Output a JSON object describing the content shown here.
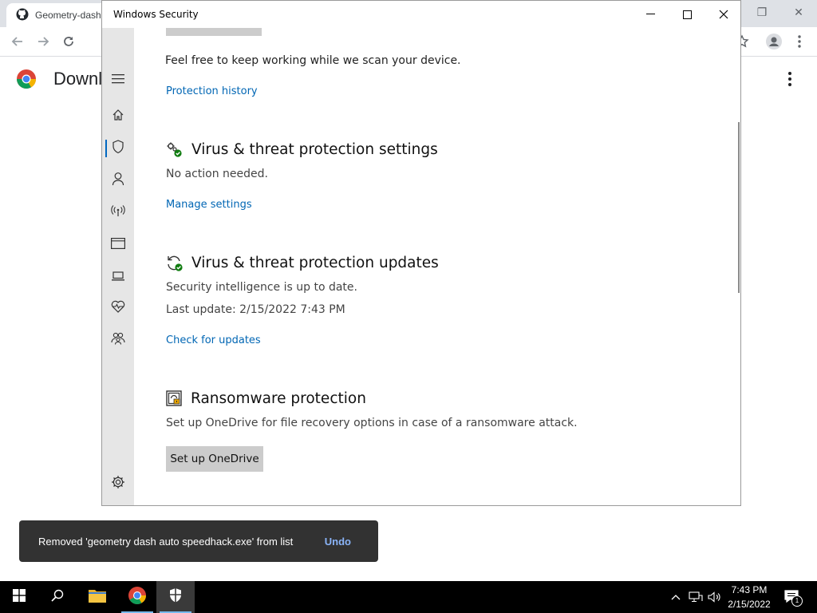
{
  "browser": {
    "tab_title": "Geometry-dash",
    "page_title": "Downl"
  },
  "window": {
    "title": "Windows Security"
  },
  "content": {
    "scan_message": "Feel free to keep working while we scan your device.",
    "protection_history_link": "Protection history",
    "settings": {
      "title": "Virus & threat protection settings",
      "status": "No action needed.",
      "link": "Manage settings"
    },
    "updates": {
      "title": "Virus & threat protection updates",
      "status": "Security intelligence is up to date.",
      "last_update": "Last update: 2/15/2022 7:43 PM",
      "link": "Check for updates"
    },
    "ransomware": {
      "title": "Ransomware protection",
      "description": "Set up OneDrive for file recovery options in case of a ransomware attack.",
      "button": "Set up OneDrive"
    }
  },
  "snackbar": {
    "message": "Removed 'geometry dash auto speedhack.exe' from list",
    "action": "Undo"
  },
  "taskbar": {
    "time": "7:43 PM",
    "date": "2/15/2022",
    "notification_count": "1"
  },
  "colors": {
    "link": "#0066b4",
    "nav_active": "#0067c0",
    "status_ok": "#107c10"
  }
}
